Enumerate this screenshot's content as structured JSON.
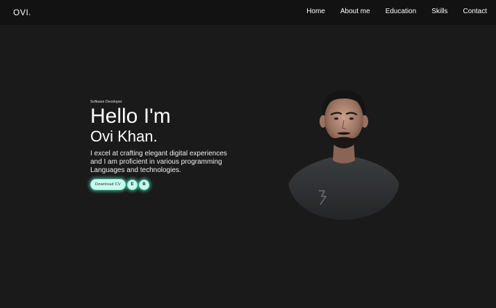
{
  "navbar": {
    "logo": "OVI.",
    "links": [
      "Home",
      "About me",
      "Education",
      "Skills",
      "Contact"
    ]
  },
  "hero": {
    "role": "Software Developer",
    "greeting": "Hello I'm",
    "name": "Ovi Khan.",
    "description": "I excel at crafting elegant digital experiences and I am proficient in various programming Languages and technologies.",
    "cv_button": "Download CV",
    "social_icons": [
      {
        "icon": "linkedin-icon",
        "glyph": "E"
      },
      {
        "icon": "github-icon",
        "glyph": "B"
      }
    ]
  },
  "colors": {
    "background": "#1a1a1b",
    "navbar": "#121213",
    "accent": "#c9fbef",
    "accent_glow": "#5af5c8"
  }
}
